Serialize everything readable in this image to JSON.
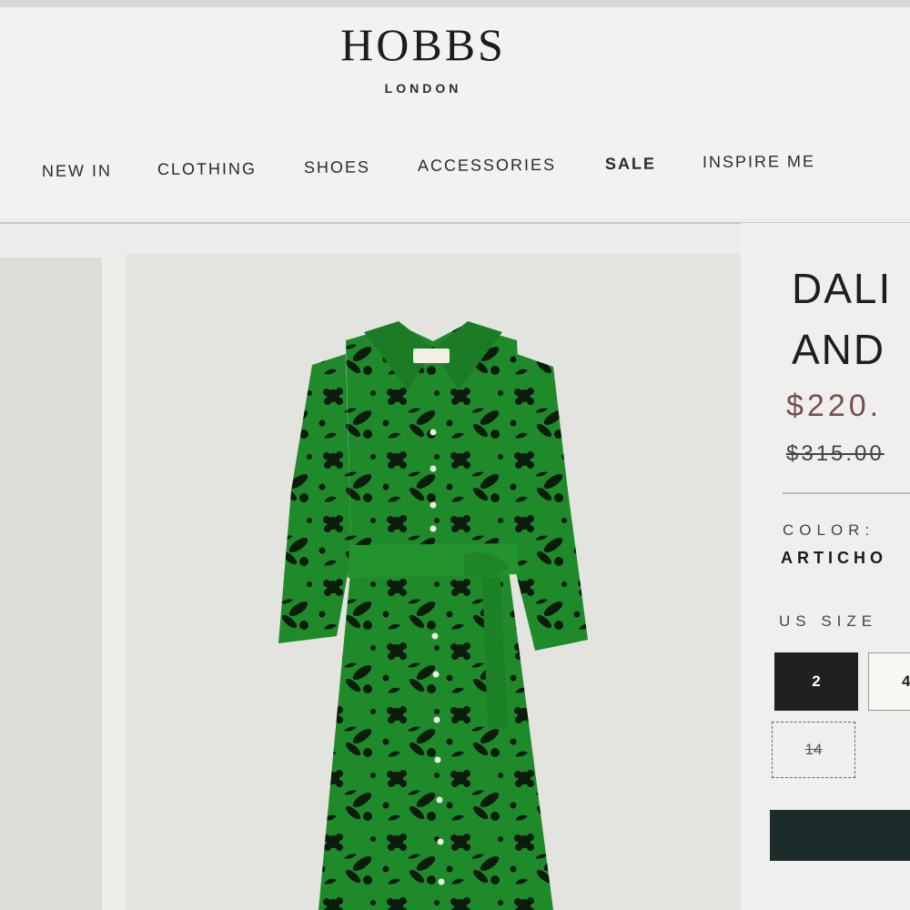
{
  "brand": {
    "name": "HOBBS",
    "sub": "LONDON"
  },
  "nav": {
    "items": [
      {
        "label": "NEW IN"
      },
      {
        "label": "CLOTHING"
      },
      {
        "label": "SHOES"
      },
      {
        "label": "ACCESSORIES"
      },
      {
        "label": "SALE"
      },
      {
        "label": "INSPIRE ME"
      }
    ]
  },
  "product": {
    "title_lines": [
      "DALI",
      "AND"
    ],
    "price_now": "$220.",
    "price_was": "$315.00",
    "color_label": "COLOR:",
    "color_value": "ARTICHO",
    "size_label": "US SIZE",
    "sizes": [
      {
        "label": "2",
        "state": "selected"
      },
      {
        "label": "4",
        "state": "available"
      },
      {
        "label": "14",
        "state": "unavailable"
      }
    ]
  },
  "colors": {
    "dress_green": "#1f8a2a",
    "dress_print": "#0b1c0c",
    "price_accent": "#7a4a52",
    "button_dark": "#1c2c2a"
  }
}
